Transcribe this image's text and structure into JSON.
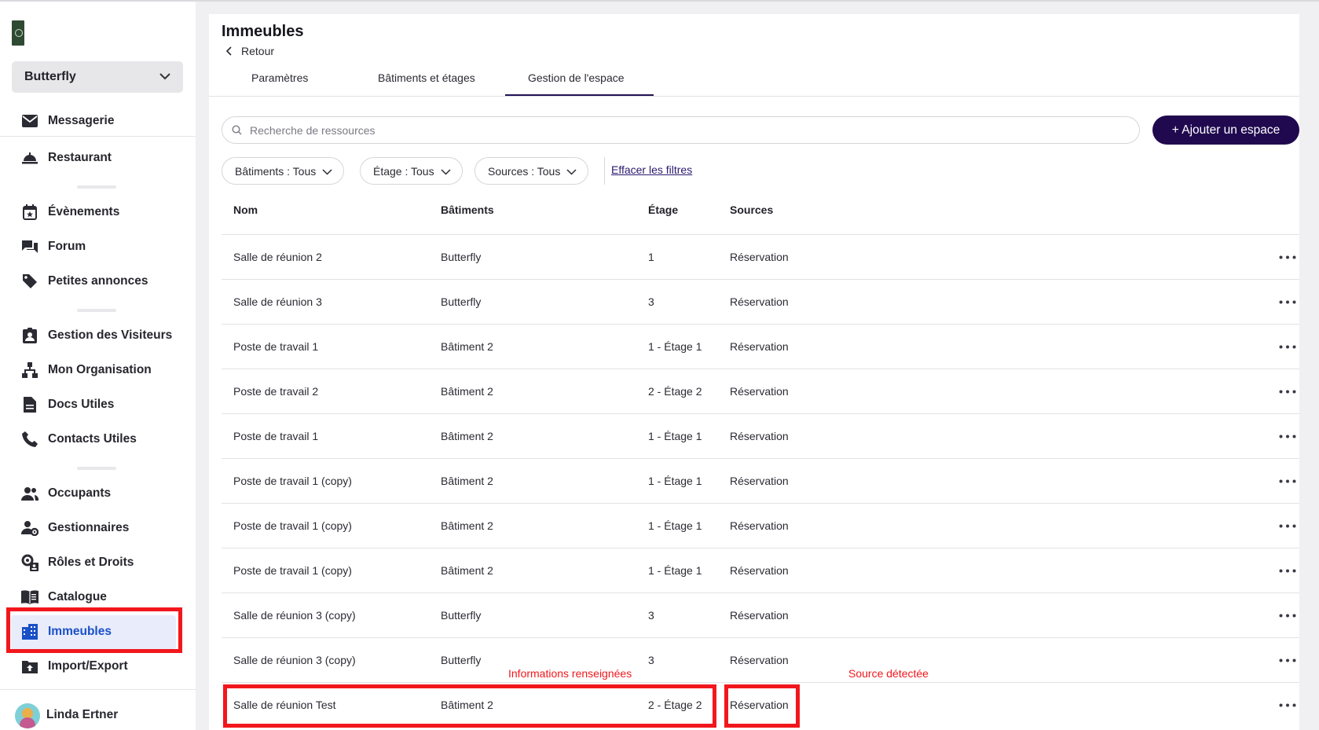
{
  "sidebar": {
    "org_name": "Butterfly",
    "items": [
      {
        "label": "Messagerie",
        "icon": "mail-icon"
      },
      {
        "label": "Restaurant",
        "icon": "cloche-icon"
      },
      {
        "label": "Évènements",
        "icon": "calendar-star-icon"
      },
      {
        "label": "Forum",
        "icon": "forum-icon"
      },
      {
        "label": "Petites annonces",
        "icon": "tag-icon"
      },
      {
        "label": "Gestion des Visiteurs",
        "icon": "visitor-badge-icon"
      },
      {
        "label": "Mon Organisation",
        "icon": "org-chart-icon"
      },
      {
        "label": "Docs Utiles",
        "icon": "document-icon"
      },
      {
        "label": "Contacts Utiles",
        "icon": "phone-icon"
      },
      {
        "label": "Occupants",
        "icon": "users-icon"
      },
      {
        "label": "Gestionnaires",
        "icon": "user-gear-icon"
      },
      {
        "label": "Rôles et Droits",
        "icon": "roles-icon"
      },
      {
        "label": "Catalogue",
        "icon": "book-icon"
      },
      {
        "label": "Immeubles",
        "icon": "building-icon",
        "active": true
      },
      {
        "label": "Import/Export",
        "icon": "import-export-icon"
      }
    ],
    "user_name": "Linda Ertner"
  },
  "page": {
    "title": "Immeubles",
    "back_label": "Retour",
    "tabs": [
      {
        "label": "Paramètres"
      },
      {
        "label": "Bâtiments et étages"
      },
      {
        "label": "Gestion de l'espace",
        "active": true
      }
    ]
  },
  "toolbar": {
    "search_placeholder": "Recherche de ressources",
    "add_button": "+ Ajouter un espace",
    "filters": [
      {
        "label": "Bâtiments : Tous"
      },
      {
        "label": "Étage : Tous"
      },
      {
        "label": "Sources : Tous"
      }
    ],
    "clear_filters": "Effacer les filtres"
  },
  "table": {
    "columns": [
      "Nom",
      "Bâtiments",
      "Étage",
      "Sources"
    ],
    "rows": [
      {
        "nom": "Salle de réunion 2",
        "batiment": "Butterfly",
        "etage": "1",
        "source": "Réservation"
      },
      {
        "nom": "Salle de réunion 3",
        "batiment": "Butterfly",
        "etage": "3",
        "source": "Réservation"
      },
      {
        "nom": "Poste de travail 1",
        "batiment": "Bâtiment 2",
        "etage": "1 - Étage 1",
        "source": "Réservation"
      },
      {
        "nom": "Poste de travail 2",
        "batiment": "Bâtiment 2",
        "etage": "2 - Étage 2",
        "source": "Réservation"
      },
      {
        "nom": "Poste de travail 1",
        "batiment": "Bâtiment 2",
        "etage": "1 - Étage 1",
        "source": "Réservation"
      },
      {
        "nom": "Poste de travail 1 (copy)",
        "batiment": "Bâtiment 2",
        "etage": "1 - Étage 1",
        "source": "Réservation"
      },
      {
        "nom": "Poste de travail 1 (copy)",
        "batiment": "Bâtiment 2",
        "etage": "1 - Étage 1",
        "source": "Réservation"
      },
      {
        "nom": "Poste de travail 1 (copy)",
        "batiment": "Bâtiment 2",
        "etage": "1 - Étage 1",
        "source": "Réservation"
      },
      {
        "nom": "Salle de réunion 3 (copy)",
        "batiment": "Butterfly",
        "etage": "3",
        "source": "Réservation"
      },
      {
        "nom": "Salle de réunion 3 (copy)",
        "batiment": "Butterfly",
        "etage": "3",
        "source": "Réservation"
      },
      {
        "nom": "Salle de réunion Test",
        "batiment": "Bâtiment 2",
        "etage": "2 - Étage 2",
        "source": "Réservation"
      }
    ]
  },
  "annotations": {
    "info_label": "Informations renseignées",
    "source_label": "Source détectée",
    "highlight_color": "#f2171c"
  },
  "colors": {
    "primary": "#20094f",
    "active_nav": "#1a50c8",
    "active_nav_bg": "#e8ecfb"
  }
}
